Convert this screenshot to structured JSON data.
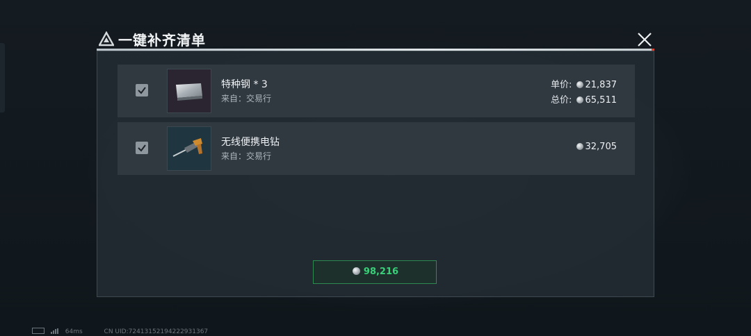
{
  "dialog": {
    "title": "一键补齐清单",
    "items": [
      {
        "name": "特种钢 * 3",
        "source": "来自：交易行",
        "checked": true,
        "icon": "steel-plate-icon",
        "unit_price_label": "单价:",
        "unit_price": "21,837",
        "total_price_label": "总价:",
        "total_price": "65,511"
      },
      {
        "name": "无线便携电钻",
        "source": "来自：交易行",
        "checked": true,
        "icon": "cordless-drill-icon",
        "price": "32,705"
      }
    ],
    "total": "98,216"
  },
  "footer": {
    "ping": "64ms",
    "uid": "CN UID:724131521942229313​67"
  },
  "colors": {
    "accent_green": "#38d17a",
    "panel": "#222b32",
    "row": "#353e45"
  }
}
